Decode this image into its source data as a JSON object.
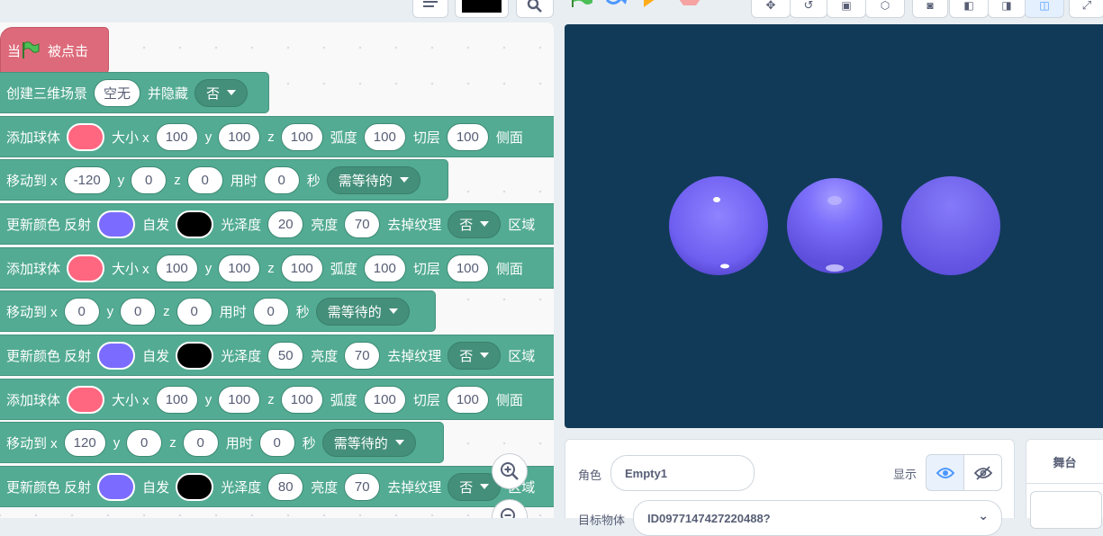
{
  "scripts": {
    "hat": {
      "when": "当",
      "clicked": "被点击"
    },
    "create_scene": {
      "label": "创建三维场景",
      "scene_value": "空无",
      "hide_label": "并隐藏",
      "hide_value": "否"
    },
    "blocks": [
      {
        "type": "add_sphere",
        "label": "添加球体",
        "color": "#ff6680",
        "size_label": "大小 x",
        "x": "100",
        "y_label": "y",
        "y": "100",
        "z_label": "z",
        "z": "100",
        "arc_label": "弧度",
        "arc": "100",
        "slice_label": "切层",
        "slice": "100",
        "side_label": "侧面"
      },
      {
        "type": "move_to",
        "label": "移动到 x",
        "x": "-120",
        "y_label": "y",
        "y": "0",
        "z_label": "z",
        "z": "0",
        "time_label": "用时",
        "time": "0",
        "sec_label": "秒",
        "wait": "需等待的"
      },
      {
        "type": "update_color",
        "label": "更新颜色 反射",
        "reflect_color": "#7b6cff",
        "emit_label": "自发",
        "emit_color": "#000000",
        "gloss_label": "光泽度",
        "gloss": "20",
        "bright_label": "亮度",
        "bright": "70",
        "texture_label": "去掉纹理",
        "texture": "否",
        "region_label": "区域"
      },
      {
        "type": "add_sphere",
        "label": "添加球体",
        "color": "#ff6680",
        "size_label": "大小 x",
        "x": "100",
        "y_label": "y",
        "y": "100",
        "z_label": "z",
        "z": "100",
        "arc_label": "弧度",
        "arc": "100",
        "slice_label": "切层",
        "slice": "100",
        "side_label": "侧面"
      },
      {
        "type": "move_to",
        "label": "移动到 x",
        "x": "0",
        "y_label": "y",
        "y": "0",
        "z_label": "z",
        "z": "0",
        "time_label": "用时",
        "time": "0",
        "sec_label": "秒",
        "wait": "需等待的"
      },
      {
        "type": "update_color",
        "label": "更新颜色 反射",
        "reflect_color": "#7b6cff",
        "emit_label": "自发",
        "emit_color": "#000000",
        "gloss_label": "光泽度",
        "gloss": "50",
        "bright_label": "亮度",
        "bright": "70",
        "texture_label": "去掉纹理",
        "texture": "否",
        "region_label": "区域"
      },
      {
        "type": "add_sphere",
        "label": "添加球体",
        "color": "#ff6680",
        "size_label": "大小 x",
        "x": "100",
        "y_label": "y",
        "y": "100",
        "z_label": "z",
        "z": "100",
        "arc_label": "弧度",
        "arc": "100",
        "slice_label": "切层",
        "slice": "100",
        "side_label": "侧面"
      },
      {
        "type": "move_to",
        "label": "移动到 x",
        "x": "120",
        "y_label": "y",
        "y": "0",
        "z_label": "z",
        "z": "0",
        "time_label": "用时",
        "time": "0",
        "sec_label": "秒",
        "wait": "需等待的"
      },
      {
        "type": "update_color",
        "label": "更新颜色 反射",
        "reflect_color": "#7b6cff",
        "emit_label": "自发",
        "emit_color": "#000000",
        "gloss_label": "光泽度",
        "gloss": "80",
        "bright_label": "亮度",
        "bright": "70",
        "texture_label": "去掉纹理",
        "texture": "否",
        "region_label": "区域"
      }
    ]
  },
  "sprite_info": {
    "role_label": "角色",
    "role_value": "Empty1",
    "show_label": "显示",
    "target_label": "目标物体",
    "target_value": "ID0977147427220488?"
  },
  "stage_panel": {
    "title": "舞台"
  },
  "colors": {
    "block_green": "#52ab92",
    "event_pink": "#dd6a7a",
    "stage_bg": "#113a58",
    "sphere": "#7b6cff",
    "accent_blue": "#4c97ff"
  },
  "icons": [
    "list-icon",
    "color-box",
    "search-icon",
    "green-flag-icon",
    "turbo-icon",
    "pause-icon",
    "stop-icon",
    "zoom-in-icon",
    "zoom-out-icon",
    "eye-icon",
    "eye-off-icon"
  ]
}
